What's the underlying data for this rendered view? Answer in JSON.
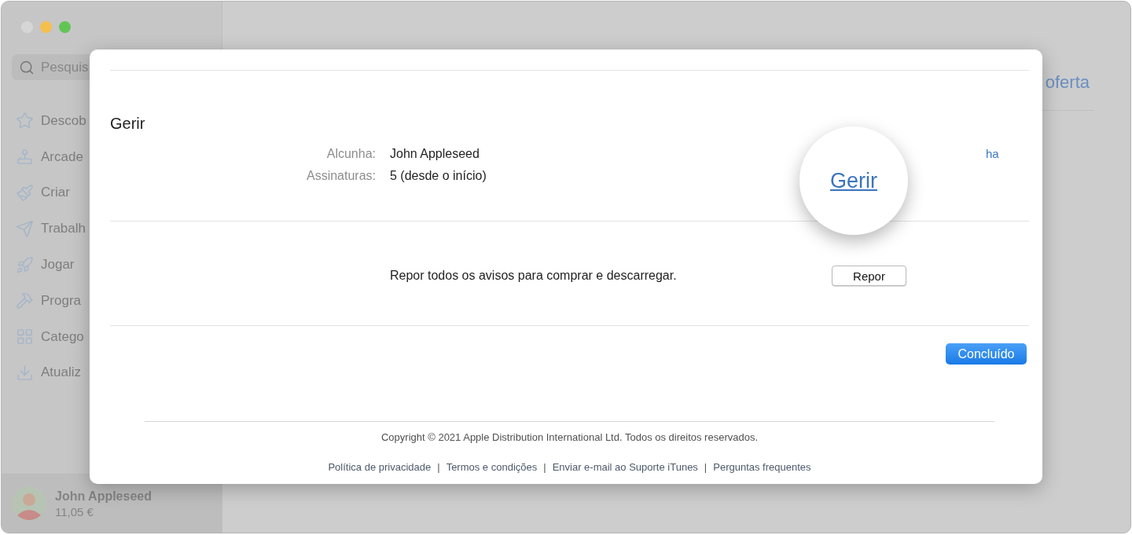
{
  "window": {
    "traffic_lights": [
      {
        "kind": "close",
        "disabled": true
      },
      {
        "kind": "minimize",
        "disabled": false
      },
      {
        "kind": "zoom",
        "disabled": false
      }
    ]
  },
  "sidebar": {
    "search": {
      "placeholder": "Pesquis"
    },
    "items": [
      {
        "label": "Descob"
      },
      {
        "label": "Arcade"
      },
      {
        "label": "Criar"
      },
      {
        "label": "Trabalh"
      },
      {
        "label": "Jogar"
      },
      {
        "label": "Progra"
      },
      {
        "label": "Catego"
      },
      {
        "label": "Atualiz"
      }
    ],
    "account": {
      "name": "John Appleseed",
      "balance": "11,05 €"
    }
  },
  "main": {
    "heading": "oferta"
  },
  "dialog": {
    "section_title": "Gerir",
    "fields": [
      {
        "label": "Alcunha:",
        "value": "John Appleseed"
      },
      {
        "label": "Assinaturas:",
        "value": "5 (desde o início)"
      }
    ],
    "side_link": "ha",
    "magnifier_link": "Gerir",
    "reset": {
      "text": "Repor todos os avisos para comprar e descarregar.",
      "button": "Repor"
    },
    "done_button": "Concluído",
    "copyright": "Copyright © 2021 Apple Distribution International Ltd. Todos os direitos reservados.",
    "footer_separator": "|",
    "footer_links": [
      "Política de privacidade",
      "Termos e condições",
      "Enviar e-mail ao Suporte iTunes",
      "Perguntas frequentes"
    ]
  }
}
